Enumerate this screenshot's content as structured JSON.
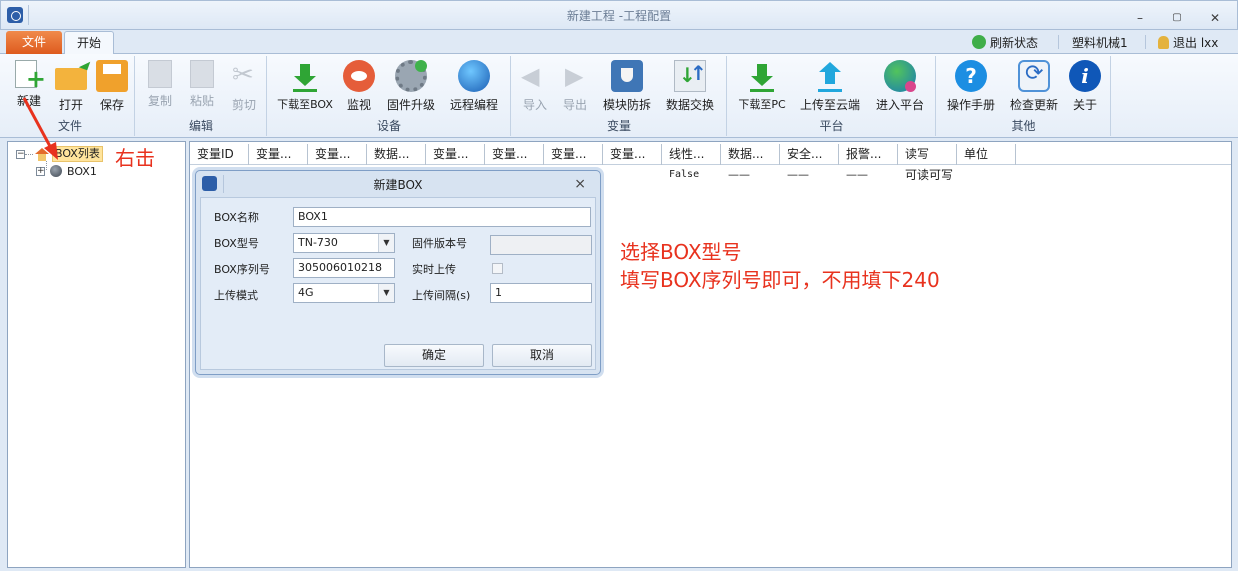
{
  "window": {
    "title": "新建工程 -工程配置",
    "min": "–",
    "max": "▢",
    "close": "✕"
  },
  "tabs": {
    "file": "文件",
    "home": "开始"
  },
  "status": {
    "refresh": "刷新状态",
    "machine": "塑料机械1",
    "logout": "退出 lxx"
  },
  "ribbon": {
    "groups": {
      "file": "文件",
      "edit": "编辑",
      "device": "设备",
      "variable": "变量",
      "platform": "平台",
      "other": "其他"
    },
    "buttons": {
      "new": "新建",
      "open": "打开",
      "save": "保存",
      "copy": "复制",
      "paste": "粘贴",
      "cut": "剪切",
      "download_box": "下载至BOX",
      "monitor": "监视",
      "firmware": "固件升级",
      "remote": "远程编程",
      "import": "导入",
      "export": "导出",
      "module_protect": "模块防拆",
      "data_exchange": "数据交换",
      "download_pc": "下载至PC",
      "upload_cloud": "上传至云端",
      "enter_platform": "进入平台",
      "manual": "操作手册",
      "check_update": "检查更新",
      "about": "关于"
    }
  },
  "tree": {
    "root": "BOX列表",
    "child": "BOX1"
  },
  "grid": {
    "headers": [
      "变量ID",
      "变量...",
      "变量...",
      "数据...",
      "变量...",
      "变量...",
      "变量...",
      "变量...",
      "线性...",
      "数据...",
      "安全...",
      "报警...",
      "读写",
      "单位"
    ],
    "row": [
      "",
      "",
      "",
      "",
      "",
      "",
      "",
      "",
      "False",
      "——",
      "——",
      "——",
      "可读可写",
      ""
    ]
  },
  "dialog": {
    "title": "新建BOX",
    "close": "⨯",
    "fields": {
      "name_label": "BOX名称",
      "name_value": "BOX1",
      "model_label": "BOX型号",
      "model_value": "TN-730",
      "firmware_label": "固件版本号",
      "firmware_value": "",
      "serial_label": "BOX序列号",
      "serial_value": "305006010218",
      "realtime_label": "实时上传",
      "mode_label": "上传模式",
      "mode_value": "4G",
      "interval_label": "上传间隔(s)",
      "interval_value": "1"
    },
    "ok": "确定",
    "cancel": "取消"
  },
  "annotations": {
    "right_click": "右击",
    "line1": "选择BOX型号",
    "line2": "填写BOX序列号即可，不用填下240",
    "color": "#e8321e"
  }
}
